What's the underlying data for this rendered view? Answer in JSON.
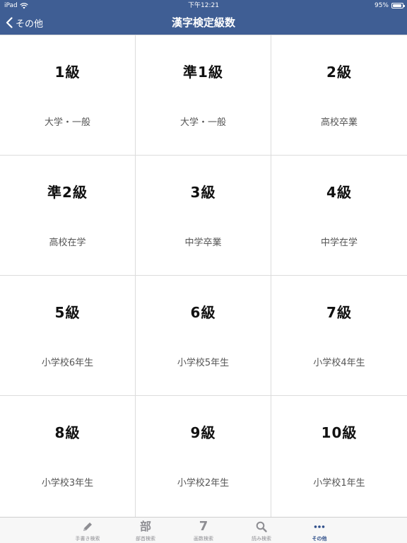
{
  "status_bar": {
    "carrier": "iPad",
    "time": "下午12:21",
    "battery": "95%",
    "battery_level": 0.95
  },
  "nav": {
    "back_label": "その他",
    "title": "漢字検定級数"
  },
  "grades": [
    {
      "level": "1級",
      "desc": "大学・一般"
    },
    {
      "level": "準1級",
      "desc": "大学・一般"
    },
    {
      "level": "2級",
      "desc": "高校卒業"
    },
    {
      "level": "準2級",
      "desc": "高校在学"
    },
    {
      "level": "3級",
      "desc": "中学卒業"
    },
    {
      "level": "4級",
      "desc": "中学在学"
    },
    {
      "level": "5級",
      "desc": "小学校6年生"
    },
    {
      "level": "6級",
      "desc": "小学校5年生"
    },
    {
      "level": "7級",
      "desc": "小学校4年生"
    },
    {
      "level": "8級",
      "desc": "小学校3年生"
    },
    {
      "level": "9級",
      "desc": "小学校2年生"
    },
    {
      "level": "10級",
      "desc": "小学校1年生"
    }
  ],
  "tabs": [
    {
      "label": "手書き検索",
      "icon": "pencil-icon"
    },
    {
      "label": "部首検索",
      "icon": "radical-icon",
      "glyph": "部"
    },
    {
      "label": "画数検索",
      "icon": "stroke-count-icon",
      "glyph": "7"
    },
    {
      "label": "読み検索",
      "icon": "magnifier-icon"
    },
    {
      "label": "その他",
      "icon": "more-icon",
      "active": true
    }
  ],
  "colors": {
    "nav_background": "#3f5e94",
    "active_tab": "#2f4f8a",
    "inactive_tab": "#8e8e93"
  }
}
